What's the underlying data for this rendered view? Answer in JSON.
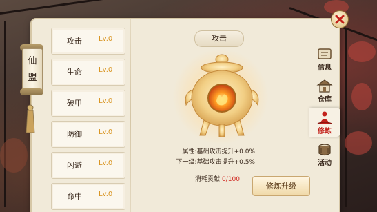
{
  "window": {
    "close_icon": "close-x-icon",
    "accent_color": "#c2221b"
  },
  "banner": {
    "text_line1": "仙",
    "text_line2": "盟"
  },
  "attributes": [
    {
      "name": "攻击",
      "level": "Lv.0"
    },
    {
      "name": "生命",
      "level": "Lv.0"
    },
    {
      "name": "破甲",
      "level": "Lv.0"
    },
    {
      "name": "防御",
      "level": "Lv.0"
    },
    {
      "name": "闪避",
      "level": "Lv.0"
    },
    {
      "name": "命中",
      "level": "Lv.0"
    }
  ],
  "detail": {
    "title": "攻击",
    "current_effect": "属性:基础攻击提升+0.0%",
    "next_effect": "下一级:基础攻击提升+0.5%",
    "cost_label": "消耗贡献:",
    "cost_value": "0/100",
    "upgrade_button": "修炼升级"
  },
  "tabs": [
    {
      "label": "信息",
      "icon": "scroll-icon",
      "active": false
    },
    {
      "label": "仓库",
      "icon": "warehouse-icon",
      "active": false
    },
    {
      "label": "修炼",
      "icon": "meditation-icon",
      "active": true
    },
    {
      "label": "活动",
      "icon": "banner-drum-icon",
      "active": false
    }
  ]
}
